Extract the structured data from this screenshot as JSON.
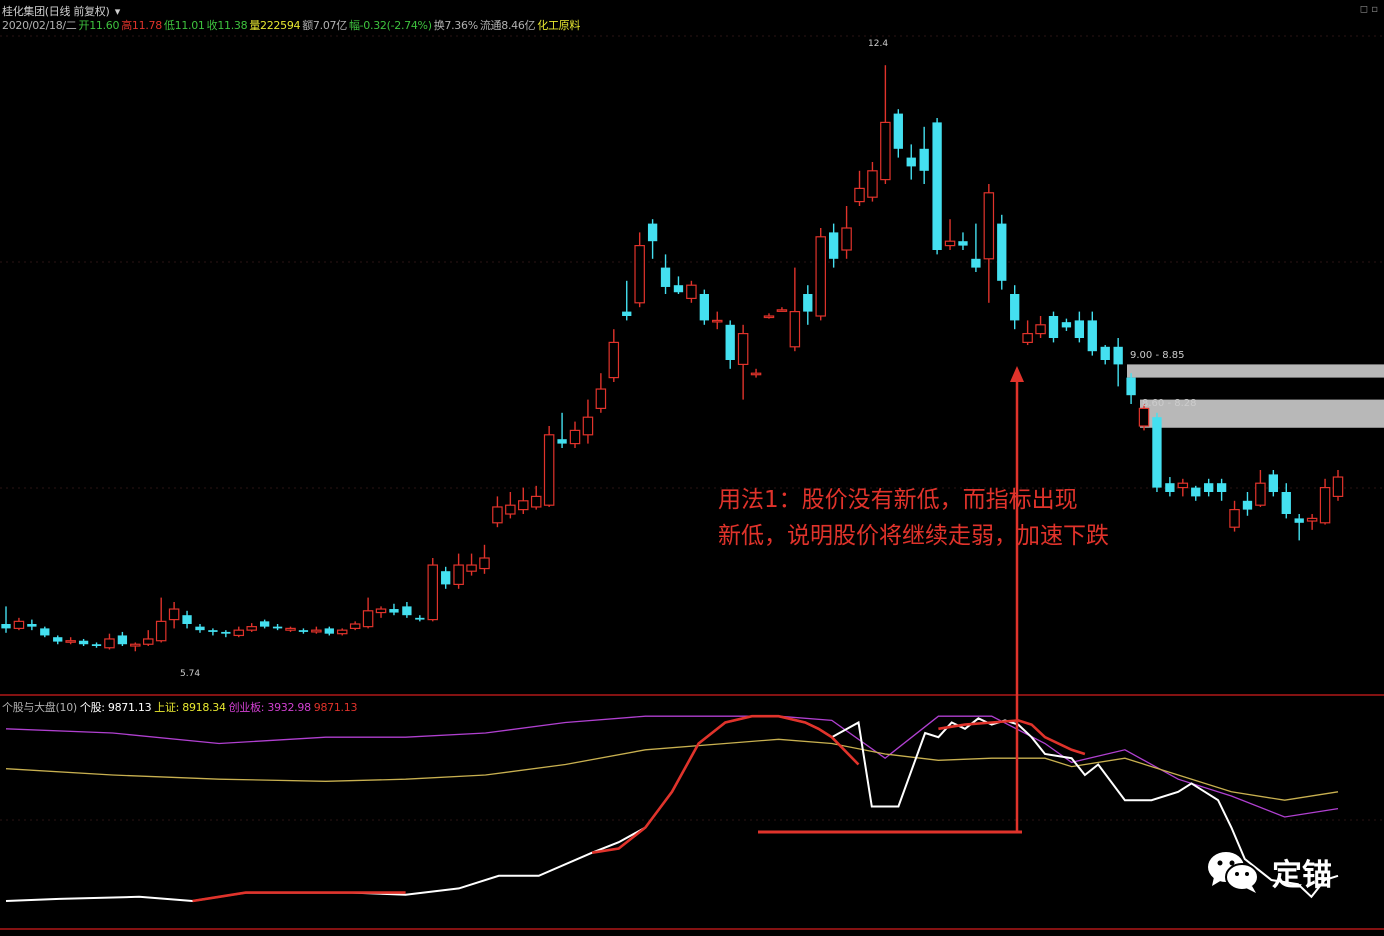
{
  "header": {
    "title": "桂化集团(日线 前复权)",
    "line2": [
      {
        "text": "2020/02/18/二",
        "color": "#b0b0b0"
      },
      {
        "text": "开11.60",
        "color": "#3ec23e"
      },
      {
        "text": "高11.78",
        "color": "#e0332b"
      },
      {
        "text": "低11.01",
        "color": "#3ec23e"
      },
      {
        "text": "收11.38",
        "color": "#3ec23e"
      },
      {
        "text": "量222594",
        "color": "#e8e830"
      },
      {
        "text": "额7.07亿",
        "color": "#b0b0b0"
      },
      {
        "text": "幅-0.32(-2.74%)",
        "color": "#3ec23e"
      },
      {
        "text": "换7.36%",
        "color": "#b0b0b0"
      },
      {
        "text": "流通8.46亿",
        "color": "#b0b0b0"
      },
      {
        "text": "化工原料",
        "color": "#e8e830"
      }
    ]
  },
  "indicator_header": [
    {
      "text": "个股与大盘(10)",
      "color": "#b0b0b0"
    },
    {
      "text": "个股: 9871.13",
      "color": "#ffffff"
    },
    {
      "text": "上证: 8918.34",
      "color": "#e8e830"
    },
    {
      "text": "创业板: 3932.98",
      "color": "#d040d0"
    },
    {
      "text": "9871.13",
      "color": "#e0332b"
    }
  ],
  "price_labels": {
    "high": "12.4",
    "low": "5.74",
    "zone1": "9.00 - 8.85",
    "zone2": "8.60 - 8.28"
  },
  "annotation": {
    "line1": "用法1：股价没有新低，而指标出现",
    "line2": "新低，说明股价将继续走弱，加速下跌"
  },
  "watermark": {
    "text": "定锚",
    "icon": "wechat-icon"
  },
  "colors": {
    "up": "#e0332b",
    "down": "#44e0f0",
    "separator": "#b01818",
    "zone": "#b8b8b8",
    "white_line": "#ffffff",
    "gold_line": "#c8b050",
    "purple_line": "#b040d0"
  },
  "chart_data": [
    {
      "type": "candlestick",
      "title": "桂化集团(日线 前复权)",
      "ylim": [
        5.3,
        12.8
      ],
      "highlighted_zones": [
        {
          "label": "9.00 - 8.85",
          "y_range": [
            8.85,
            9.0
          ]
        },
        {
          "label": "8.60 - 8.28",
          "y_range": [
            8.28,
            8.6
          ]
        }
      ],
      "candles": [
        [
          6.05,
          6.0,
          6.25,
          5.95
        ],
        [
          6.0,
          6.08,
          6.12,
          5.98
        ],
        [
          6.05,
          6.02,
          6.1,
          5.98
        ],
        [
          6.0,
          5.92,
          6.02,
          5.9
        ],
        [
          5.9,
          5.85,
          5.92,
          5.82
        ],
        [
          5.85,
          5.86,
          5.9,
          5.82
        ],
        [
          5.86,
          5.82,
          5.88,
          5.8
        ],
        [
          5.82,
          5.8,
          5.84,
          5.78
        ],
        [
          5.78,
          5.88,
          5.94,
          5.76
        ],
        [
          5.92,
          5.82,
          5.96,
          5.8
        ],
        [
          5.8,
          5.82,
          5.84,
          5.74
        ],
        [
          5.82,
          5.88,
          5.98,
          5.8
        ],
        [
          5.86,
          6.08,
          6.35,
          5.84
        ],
        [
          6.1,
          6.22,
          6.3,
          6.0
        ],
        [
          6.15,
          6.05,
          6.2,
          6.0
        ],
        [
          6.02,
          5.98,
          6.05,
          5.95
        ],
        [
          5.98,
          5.96,
          6.0,
          5.92
        ],
        [
          5.96,
          5.94,
          5.98,
          5.9
        ],
        [
          5.92,
          5.98,
          6.02,
          5.9
        ],
        [
          5.98,
          6.02,
          6.06,
          5.96
        ],
        [
          6.08,
          6.02,
          6.1,
          6.0
        ],
        [
          6.02,
          6.0,
          6.05,
          5.98
        ],
        [
          5.98,
          6.0,
          6.02,
          5.96
        ],
        [
          5.98,
          5.96,
          6.0,
          5.94
        ],
        [
          5.96,
          5.98,
          6.02,
          5.94
        ],
        [
          6.0,
          5.94,
          6.02,
          5.92
        ],
        [
          5.94,
          5.98,
          6.0,
          5.92
        ],
        [
          6.0,
          6.05,
          6.08,
          5.98
        ],
        [
          6.02,
          6.2,
          6.35,
          6.0
        ],
        [
          6.18,
          6.22,
          6.25,
          6.12
        ],
        [
          6.22,
          6.18,
          6.28,
          6.15
        ],
        [
          6.25,
          6.15,
          6.3,
          6.12
        ],
        [
          6.12,
          6.1,
          6.15,
          6.08
        ],
        [
          6.1,
          6.72,
          6.8,
          6.08
        ],
        [
          6.65,
          6.5,
          6.7,
          6.45
        ],
        [
          6.5,
          6.72,
          6.85,
          6.45
        ],
        [
          6.65,
          6.72,
          6.85,
          6.6
        ],
        [
          6.68,
          6.8,
          6.95,
          6.62
        ],
        [
          7.2,
          7.38,
          7.5,
          7.15
        ],
        [
          7.3,
          7.4,
          7.55,
          7.25
        ],
        [
          7.35,
          7.45,
          7.6,
          7.3
        ],
        [
          7.38,
          7.5,
          7.62,
          7.35
        ],
        [
          7.4,
          8.2,
          8.3,
          7.38
        ],
        [
          8.15,
          8.1,
          8.45,
          8.05
        ],
        [
          8.1,
          8.25,
          8.35,
          8.05
        ],
        [
          8.2,
          8.4,
          8.6,
          8.1
        ],
        [
          8.5,
          8.72,
          8.9,
          8.45
        ],
        [
          8.85,
          9.25,
          9.4,
          8.8
        ],
        [
          9.6,
          9.55,
          9.95,
          9.5
        ],
        [
          9.7,
          10.35,
          10.5,
          9.65
        ],
        [
          10.6,
          10.4,
          10.65,
          10.2
        ],
        [
          10.1,
          9.88,
          10.25,
          9.8
        ],
        [
          9.9,
          9.82,
          10.0,
          9.8
        ],
        [
          9.75,
          9.9,
          9.95,
          9.7
        ],
        [
          9.8,
          9.5,
          9.85,
          9.45
        ],
        [
          9.5,
          9.5,
          9.6,
          9.4
        ],
        [
          9.45,
          9.05,
          9.5,
          8.95
        ],
        [
          9.0,
          9.35,
          9.45,
          8.6
        ],
        [
          8.9,
          8.9,
          8.95,
          8.85
        ],
        [
          9.55,
          9.55,
          9.58,
          9.52
        ],
        [
          9.62,
          9.62,
          9.65,
          9.6
        ],
        [
          9.2,
          9.6,
          10.1,
          9.15
        ],
        [
          9.8,
          9.6,
          9.9,
          9.45
        ],
        [
          9.55,
          10.45,
          10.55,
          9.5
        ],
        [
          10.5,
          10.2,
          10.6,
          10.1
        ],
        [
          10.3,
          10.55,
          10.8,
          10.2
        ],
        [
          10.85,
          11.0,
          11.2,
          10.8
        ],
        [
          10.9,
          11.2,
          11.3,
          10.85
        ],
        [
          11.1,
          11.75,
          12.4,
          11.05
        ],
        [
          11.85,
          11.45,
          11.9,
          11.35
        ],
        [
          11.35,
          11.25,
          11.5,
          11.1
        ],
        [
          11.45,
          11.2,
          11.7,
          11.05
        ],
        [
          11.75,
          10.3,
          11.8,
          10.25
        ],
        [
          10.35,
          10.4,
          10.65,
          10.3
        ],
        [
          10.4,
          10.35,
          10.5,
          10.3
        ],
        [
          10.2,
          10.1,
          10.6,
          10.05
        ],
        [
          10.2,
          10.95,
          11.05,
          9.7
        ],
        [
          10.6,
          9.95,
          10.7,
          9.85
        ],
        [
          9.8,
          9.5,
          9.9,
          9.4
        ],
        [
          9.25,
          9.35,
          9.5,
          9.22
        ],
        [
          9.35,
          9.45,
          9.55,
          9.3
        ],
        [
          9.55,
          9.3,
          9.6,
          9.25
        ],
        [
          9.48,
          9.42,
          9.52,
          9.38
        ],
        [
          9.5,
          9.3,
          9.6,
          9.25
        ],
        [
          9.5,
          9.15,
          9.6,
          9.1
        ],
        [
          9.2,
          9.05,
          9.22,
          9.0
        ],
        [
          9.2,
          9.0,
          9.3,
          8.75
        ],
        [
          8.85,
          8.65,
          8.9,
          8.55
        ],
        [
          8.3,
          8.5,
          8.55,
          8.25
        ],
        [
          8.4,
          7.6,
          8.45,
          7.55
        ],
        [
          7.65,
          7.55,
          7.72,
          7.5
        ],
        [
          7.6,
          7.65,
          7.7,
          7.5
        ],
        [
          7.6,
          7.5,
          7.62,
          7.45
        ],
        [
          7.65,
          7.55,
          7.7,
          7.5
        ],
        [
          7.65,
          7.55,
          7.7,
          7.45
        ],
        [
          7.15,
          7.35,
          7.45,
          7.1
        ],
        [
          7.45,
          7.35,
          7.55,
          7.28
        ],
        [
          7.4,
          7.65,
          7.8,
          7.38
        ],
        [
          7.75,
          7.55,
          7.8,
          7.5
        ],
        [
          7.55,
          7.3,
          7.65,
          7.25
        ],
        [
          7.25,
          7.2,
          7.3,
          7.0
        ],
        [
          7.22,
          7.25,
          7.3,
          7.12
        ],
        [
          7.2,
          7.6,
          7.7,
          7.18
        ],
        [
          7.5,
          7.72,
          7.8,
          7.45
        ]
      ]
    },
    {
      "type": "line",
      "title": "个股与大盘(10)",
      "ylim": [
        0,
        100
      ],
      "series": [
        {
          "name": "个股",
          "x": [
            0,
            4,
            10,
            14,
            18,
            22,
            26,
            30,
            34,
            37,
            40,
            44,
            46,
            48,
            50,
            52,
            54,
            56,
            57,
            58,
            60,
            61,
            62,
            64,
            65,
            67,
            69,
            70,
            71,
            72,
            73,
            74,
            75,
            76,
            77,
            78,
            80,
            81,
            82,
            84,
            86,
            88,
            89,
            90,
            91,
            92,
            93,
            95,
            97,
            98,
            99,
            100
          ],
          "y": [
            10,
            11,
            12,
            10,
            14,
            14,
            14,
            13,
            16,
            22,
            22,
            33,
            38,
            45,
            62,
            85,
            95,
            98,
            98,
            98,
            95,
            92,
            88,
            95,
            55,
            55,
            90,
            88,
            95,
            92,
            97,
            94,
            96,
            94,
            88,
            80,
            78,
            70,
            75,
            58,
            58,
            62,
            66,
            62,
            58,
            45,
            30,
            20,
            18,
            12,
            20,
            22
          ],
          "highlight": [
            {
              "x": [
                14,
                16,
                18,
                22,
                26,
                30
              ],
              "y": [
                10,
                12,
                14,
                14,
                14,
                14
              ]
            },
            {
              "x": [
                44,
                46,
                48,
                50,
                52,
                54,
                56,
                57,
                58,
                60,
                61,
                62,
                64
              ],
              "y": [
                33,
                35,
                45,
                62,
                85,
                95,
                98,
                98,
                98,
                95,
                92,
                88,
                75
              ]
            },
            {
              "x": [
                70,
                72,
                74,
                76,
                77,
                78,
                80,
                81
              ],
              "y": [
                92,
                94,
                95,
                96,
                94,
                88,
                82,
                80
              ]
            }
          ]
        },
        {
          "name": "上证",
          "x": [
            0,
            8,
            16,
            24,
            30,
            36,
            42,
            48,
            54,
            58,
            62,
            66,
            70,
            74,
            78,
            80,
            84,
            88,
            92,
            96,
            100
          ],
          "y": [
            73,
            70,
            68,
            67,
            68,
            70,
            75,
            82,
            85,
            87,
            85,
            80,
            77,
            78,
            78,
            74,
            78,
            70,
            62,
            58,
            62
          ],
          "color": "#c8b050"
        },
        {
          "name": "创业板",
          "x": [
            0,
            8,
            16,
            24,
            30,
            36,
            42,
            48,
            54,
            58,
            62,
            66,
            70,
            74,
            78,
            80,
            84,
            88,
            92,
            96,
            100
          ],
          "y": [
            92,
            90,
            85,
            88,
            88,
            90,
            95,
            98,
            98,
            98,
            96,
            78,
            98,
            98,
            85,
            76,
            82,
            68,
            60,
            50,
            54
          ],
          "color": "#b040d0"
        }
      ]
    }
  ]
}
